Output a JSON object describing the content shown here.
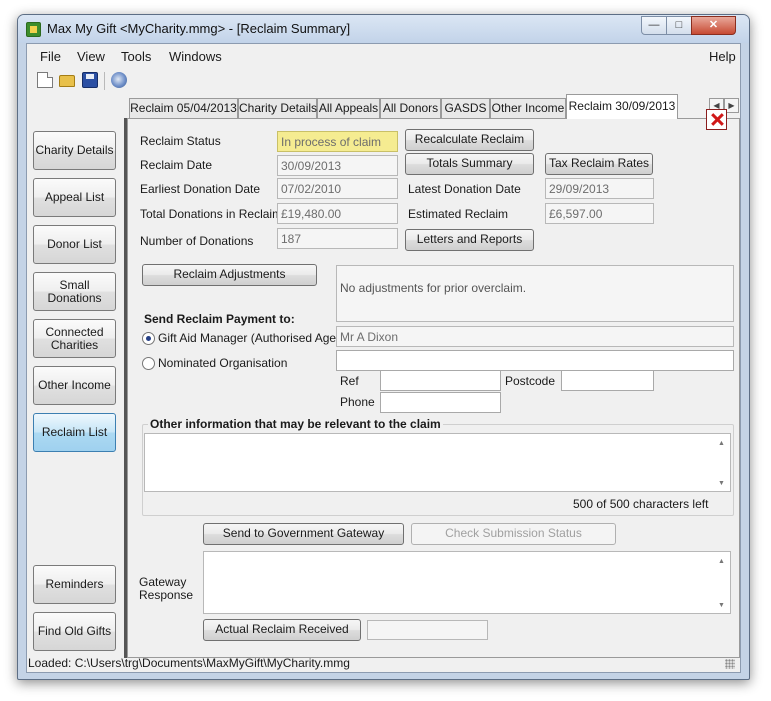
{
  "window": {
    "title": "Max My Gift <MyCharity.mmg>  - [Reclaim Summary]"
  },
  "menu": {
    "file": "File",
    "view": "View",
    "tools": "Tools",
    "windows": "Windows",
    "help": "Help"
  },
  "tabs": [
    "Reclaim 05/04/2013",
    "Charity Details",
    "All Appeals",
    "All Donors",
    "GASDS",
    "Other Income",
    "Reclaim 30/09/2013"
  ],
  "sidebar": {
    "charity_details": "Charity Details",
    "appeal_list": "Appeal List",
    "donor_list": "Donor List",
    "small_donations": "Small Donations",
    "connected_charities": "Connected Charities",
    "other_income": "Other Income",
    "reclaim_list": "Reclaim List",
    "reminders": "Reminders",
    "find_old_gifts": "Find Old Gifts"
  },
  "reclaim": {
    "status_label": "Reclaim Status",
    "status_value": "In process of claim",
    "date_label": "Reclaim Date",
    "date_value": "30/09/2013",
    "earliest_label": "Earliest Donation Date",
    "earliest_value": "07/02/2010",
    "latest_label": "Latest Donation Date",
    "latest_value": "29/09/2013",
    "total_label": "Total Donations in Reclaim",
    "total_value": "£19,480.00",
    "estimated_label": "Estimated Reclaim",
    "estimated_value": "£6,597.00",
    "count_label": "Number of Donations",
    "count_value": "187"
  },
  "buttons": {
    "recalculate": "Recalculate Reclaim",
    "totals_summary": "Totals Summary",
    "tax_rates": "Tax Reclaim Rates",
    "letters_reports": "Letters and Reports",
    "reclaim_adjustments": "Reclaim Adjustments",
    "send_gateway": "Send to Government Gateway",
    "check_status": "Check Submission Status",
    "actual_received": "Actual Reclaim Received"
  },
  "adjustments": {
    "text": "No adjustments for prior overclaim."
  },
  "payment": {
    "heading": "Send Reclaim Payment to:",
    "option_agent": "Gift Aid Manager (Authorised Agent)",
    "agent_value": "Mr A Dixon",
    "option_org": "Nominated Organisation",
    "ref_label": "Ref",
    "postcode_label": "Postcode",
    "phone_label": "Phone"
  },
  "other_info": {
    "heading": "Other information that may be relevant to the claim",
    "chars_left": "500 of 500 characters left"
  },
  "gateway": {
    "label": "Gateway Response"
  },
  "statusbar": {
    "text": "Loaded: C:\\Users\\trg\\Documents\\MaxMyGift\\MyCharity.mmg"
  },
  "colors": {
    "status_highlight": "#f5ec91",
    "active_sidebar": "#acd9f2",
    "close_red": "#d01818"
  }
}
